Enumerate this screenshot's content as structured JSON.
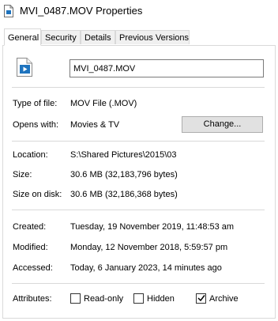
{
  "window": {
    "title": "MVI_0487.MOV Properties",
    "icon": "file-icon"
  },
  "tabs": [
    {
      "label": "General",
      "active": true
    },
    {
      "label": "Security",
      "active": false
    },
    {
      "label": "Details",
      "active": false
    },
    {
      "label": "Previous Versions",
      "active": false
    }
  ],
  "general": {
    "file_name": "MVI_0487.MOV",
    "file_icon": "video-file-icon",
    "type_label": "Type of file:",
    "type_value": "MOV File (.MOV)",
    "opens_label": "Opens with:",
    "opens_value": "Movies & TV",
    "change_button": "Change...",
    "location_label": "Location:",
    "location_value": "S:\\Shared Pictures\\2015\\03",
    "size_label": "Size:",
    "size_value": "30.6 MB (32,183,796 bytes)",
    "size_on_disk_label": "Size on disk:",
    "size_on_disk_value": "30.6 MB (32,186,368 bytes)",
    "created_label": "Created:",
    "created_value": "Tuesday, 19 November 2019, 11:48:53 am",
    "modified_label": "Modified:",
    "modified_value": "Monday, 12 November 2018, 5:59:57 pm",
    "accessed_label": "Accessed:",
    "accessed_value": "Today, 6 January 2023, 14 minutes ago",
    "attributes_label": "Attributes:",
    "attributes": [
      {
        "label": "Read-only",
        "checked": false
      },
      {
        "label": "Hidden",
        "checked": false
      },
      {
        "label": "Archive",
        "checked": true
      }
    ]
  },
  "colors": {
    "icon_blue": "#1e73be",
    "accent": "#0078d7"
  }
}
